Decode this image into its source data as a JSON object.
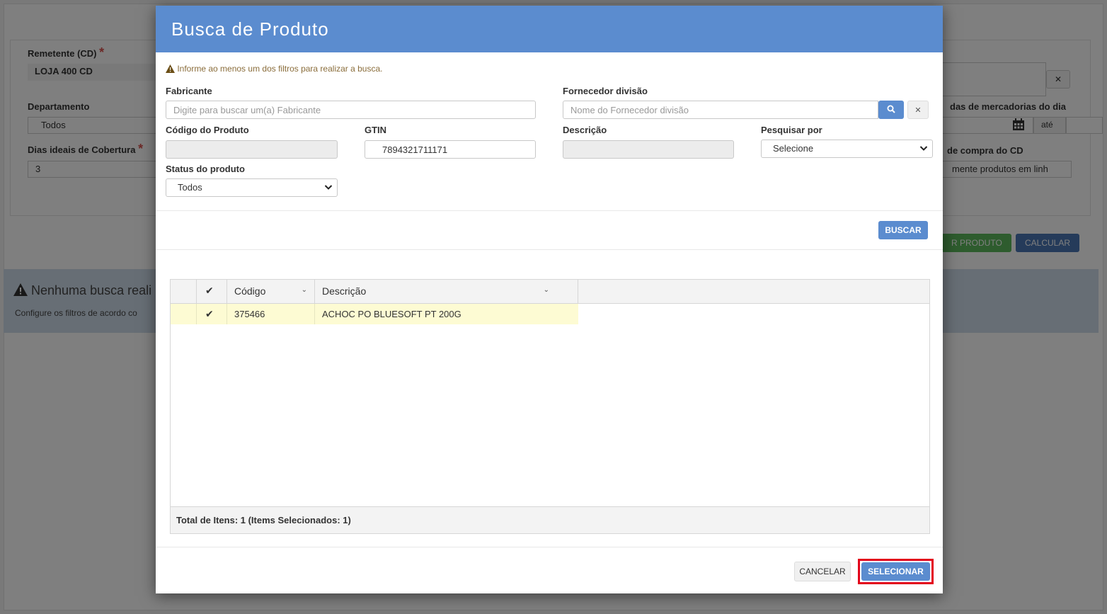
{
  "background": {
    "remetente_label": "Remetente (CD)",
    "remetente_value": "LOJA 400 CD",
    "departamento_label": "Departamento",
    "departamento_value": "Todos",
    "dias_label": "Dias ideais de Cobertura",
    "dias_value": "3",
    "saidas_label": "das de mercadorias do dia",
    "ate_label": "até",
    "compra_label": "de compra do CD",
    "compra_value": "mente produtos em linh",
    "produto_btn": "R PRODUTO",
    "calcular_btn": "CALCULAR",
    "alert_title": "Nenhuma busca reali",
    "alert_sub": "Configure os filtros de acordo co"
  },
  "modal": {
    "title": "Busca de Produto",
    "warning": "Informe ao menos um dos filtros para realizar a busca.",
    "fabricante": {
      "label": "Fabricante",
      "placeholder": "Digite para buscar um(a) Fabricante"
    },
    "fornecedor": {
      "label": "Fornecedor divisão",
      "placeholder": "Nome do Fornecedor divisão"
    },
    "codigo": {
      "label": "Código do Produto",
      "value": ""
    },
    "gtin": {
      "label": "GTIN",
      "value": "7894321711171"
    },
    "descricao": {
      "label": "Descrição",
      "value": ""
    },
    "pesquisar": {
      "label": "Pesquisar por",
      "value": "Selecione"
    },
    "status": {
      "label": "Status do produto",
      "value": "Todos"
    },
    "buscar_btn": "BUSCAR",
    "grid": {
      "columns": [
        "Código",
        "Descrição"
      ],
      "rows": [
        {
          "codigo": "375466",
          "descricao": "ACHOC PO BLUESOFT PT 200G",
          "selected": true
        }
      ],
      "footer": "Total de Itens: 1 (Items Selecionados: 1)"
    },
    "cancelar_btn": "CANCELAR",
    "selecionar_btn": "SELECIONAR"
  },
  "colors": {
    "header": "#5b8ccf",
    "primary": "#5b8ccf",
    "selected_row": "#fdfbd3",
    "highlight": "#e3001b",
    "success": "#5cb85c"
  }
}
